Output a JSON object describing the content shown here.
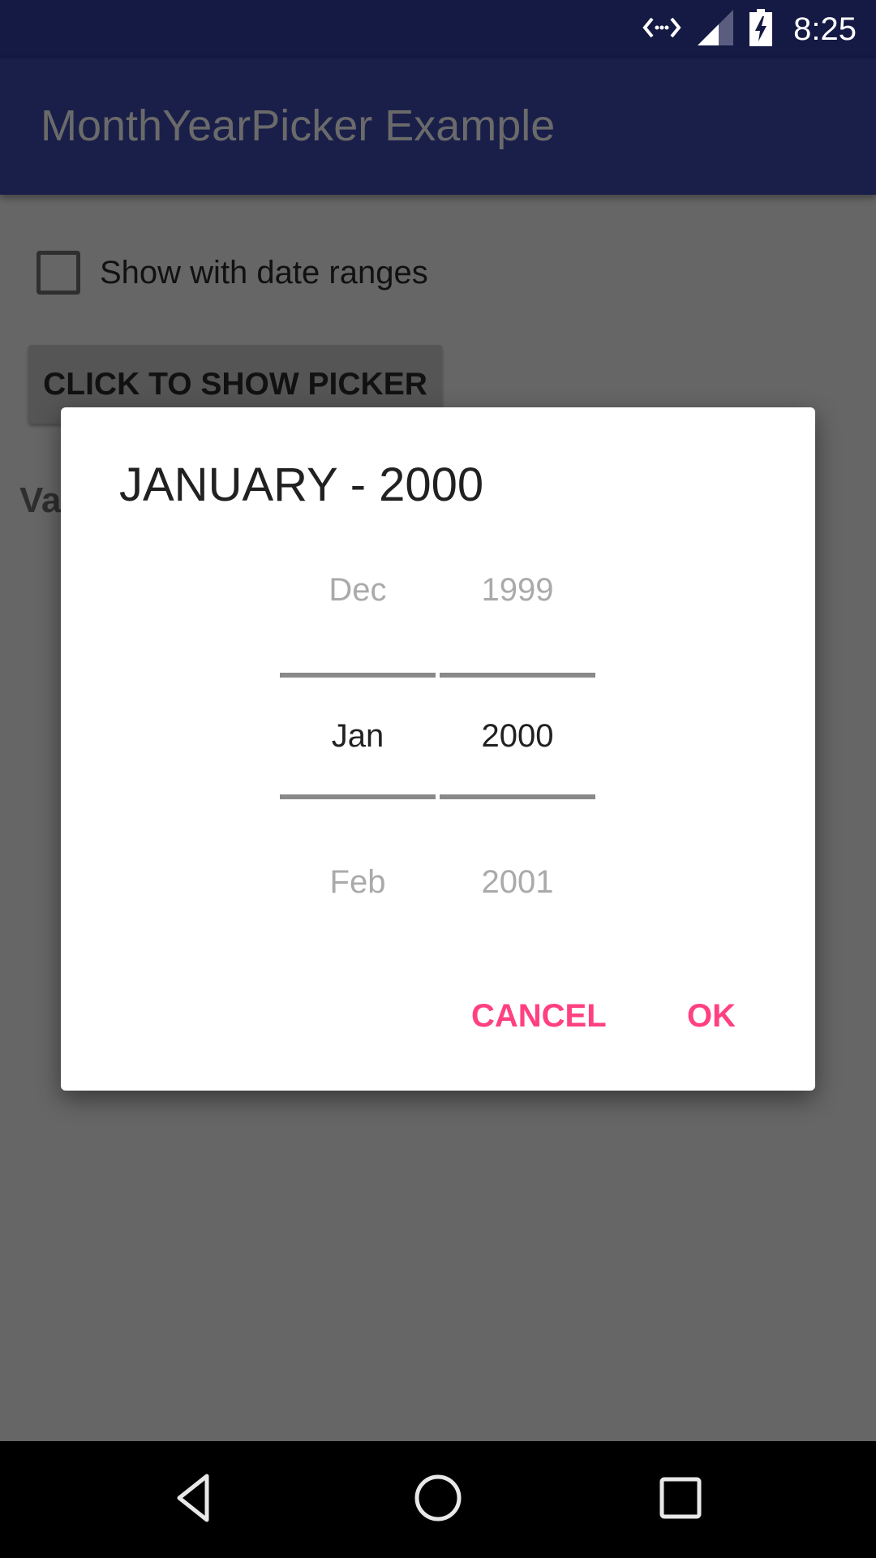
{
  "status_bar": {
    "time": "8:25",
    "icons": [
      "data-sync-icon",
      "cell-signal-icon",
      "battery-charging-icon"
    ]
  },
  "app_bar": {
    "title": "MonthYearPicker Example"
  },
  "content": {
    "checkbox_label": "Show with date ranges",
    "checkbox_checked": false,
    "show_picker_button": "CLICK TO SHOW PICKER",
    "value_label_visible": "Va"
  },
  "dialog": {
    "title": "JANUARY - 2000",
    "month_picker": {
      "prev": "Dec",
      "current": "Jan",
      "next": "Feb"
    },
    "year_picker": {
      "prev": "1999",
      "current": "2000",
      "next": "2001"
    },
    "cancel_label": "CANCEL",
    "ok_label": "OK",
    "accent_color": "#ff4081"
  },
  "nav_bar": {
    "buttons": [
      "back-icon",
      "home-icon",
      "recents-icon"
    ]
  }
}
